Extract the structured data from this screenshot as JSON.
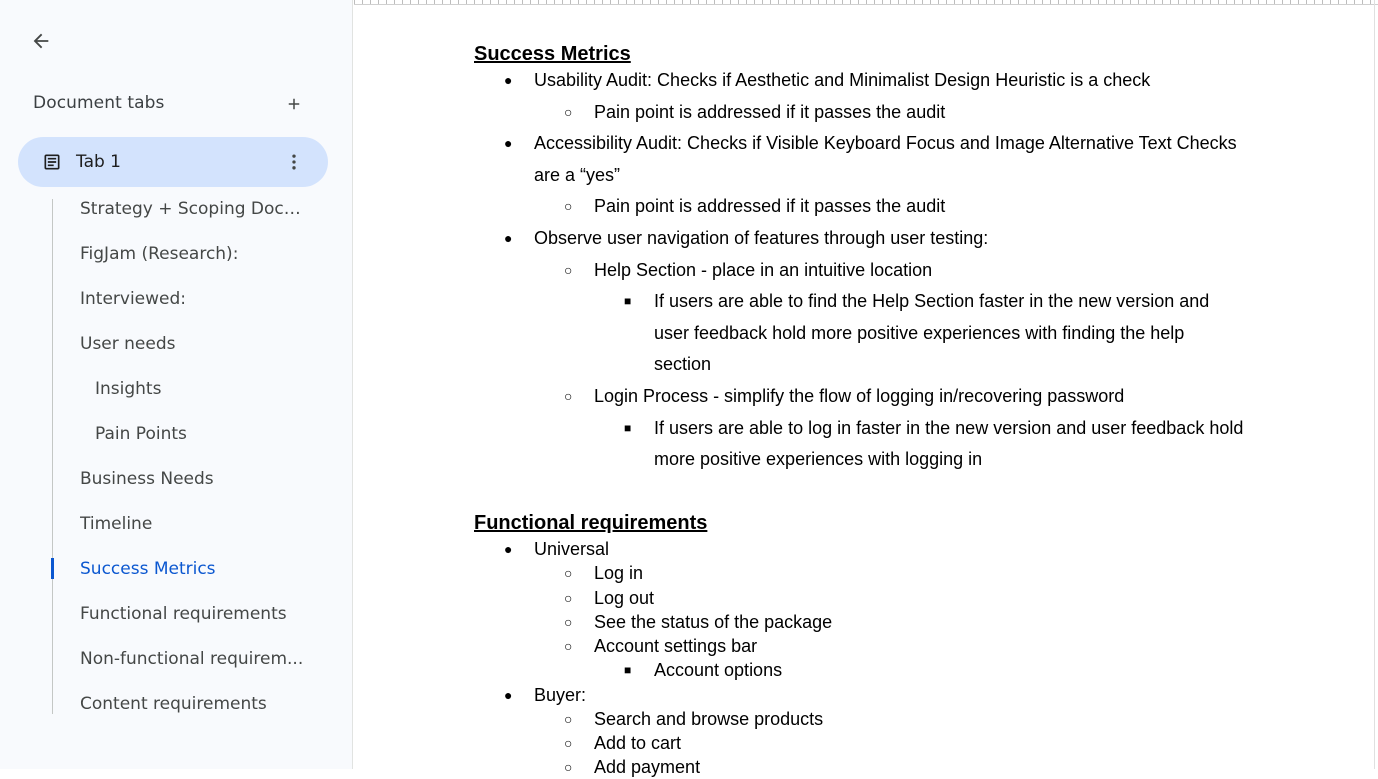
{
  "sidebar": {
    "back_icon": "arrow-left-icon",
    "tabs_header": "Document tabs",
    "add_icon": "plus-icon",
    "active_tab": {
      "label": "Tab 1",
      "icon": "document-icon",
      "more_icon": "more-vert-icon"
    },
    "outline": [
      {
        "label": "Strategy + Scoping Docu...",
        "level": 1,
        "active": false
      },
      {
        "label": "FigJam (Research):",
        "level": 1,
        "active": false
      },
      {
        "label": "Interviewed:",
        "level": 1,
        "active": false
      },
      {
        "label": "User needs",
        "level": 1,
        "active": false
      },
      {
        "label": "Insights",
        "level": 2,
        "active": false
      },
      {
        "label": "Pain Points",
        "level": 2,
        "active": false
      },
      {
        "label": "Business Needs",
        "level": 1,
        "active": false
      },
      {
        "label": "Timeline",
        "level": 1,
        "active": false
      },
      {
        "label": "Success Metrics",
        "level": 1,
        "active": true
      },
      {
        "label": "Functional requirements",
        "level": 1,
        "active": false
      },
      {
        "label": "Non-functional requirem...",
        "level": 1,
        "active": false
      },
      {
        "label": "Content requirements",
        "level": 1,
        "active": false
      }
    ],
    "accent_color": "#0b57d0",
    "active_tab_bg": "#d3e3fd"
  },
  "document": {
    "success_heading": "Success Metrics",
    "success_items": {
      "usability": "Usability Audit: Checks if Aesthetic and Minimalist Design Heuristic is a check",
      "usability_sub": "Pain point is addressed if it passes the audit",
      "accessibility_line1": "Accessibility Audit: Checks if Visible Keyboard Focus and Image Alternative Text Checks",
      "accessibility_line2": "are a “yes”",
      "accessibility_sub": "Pain point is addressed if it passes the audit",
      "observe": "Observe user navigation of features through user testing:",
      "help_section": "Help Section - place in an intuitive location",
      "help_detail_line1": "If users are able to find the Help Section faster in the new version and",
      "help_detail_line2": "user feedback hold more positive experiences with finding the help",
      "help_detail_line3": "section",
      "login_process": "Login Process - simplify the flow of logging in/recovering password",
      "login_detail_line1": "If users are able to log in faster in the new version and user feedback hold",
      "login_detail_line2": "more positive experiences with logging in"
    },
    "functional_heading": "Functional requirements",
    "functional_items": {
      "universal": "Universal",
      "log_in": "Log in",
      "log_out": "Log out",
      "package_status": "See the status of the package",
      "account_settings": "Account settings bar",
      "account_options": "Account options",
      "buyer": "Buyer:",
      "search_browse": "Search and browse products",
      "add_to_cart": "Add to cart",
      "add_payment": "Add payment"
    },
    "bullets": {
      "level1": "●",
      "level2": "○",
      "level3": "■"
    }
  }
}
